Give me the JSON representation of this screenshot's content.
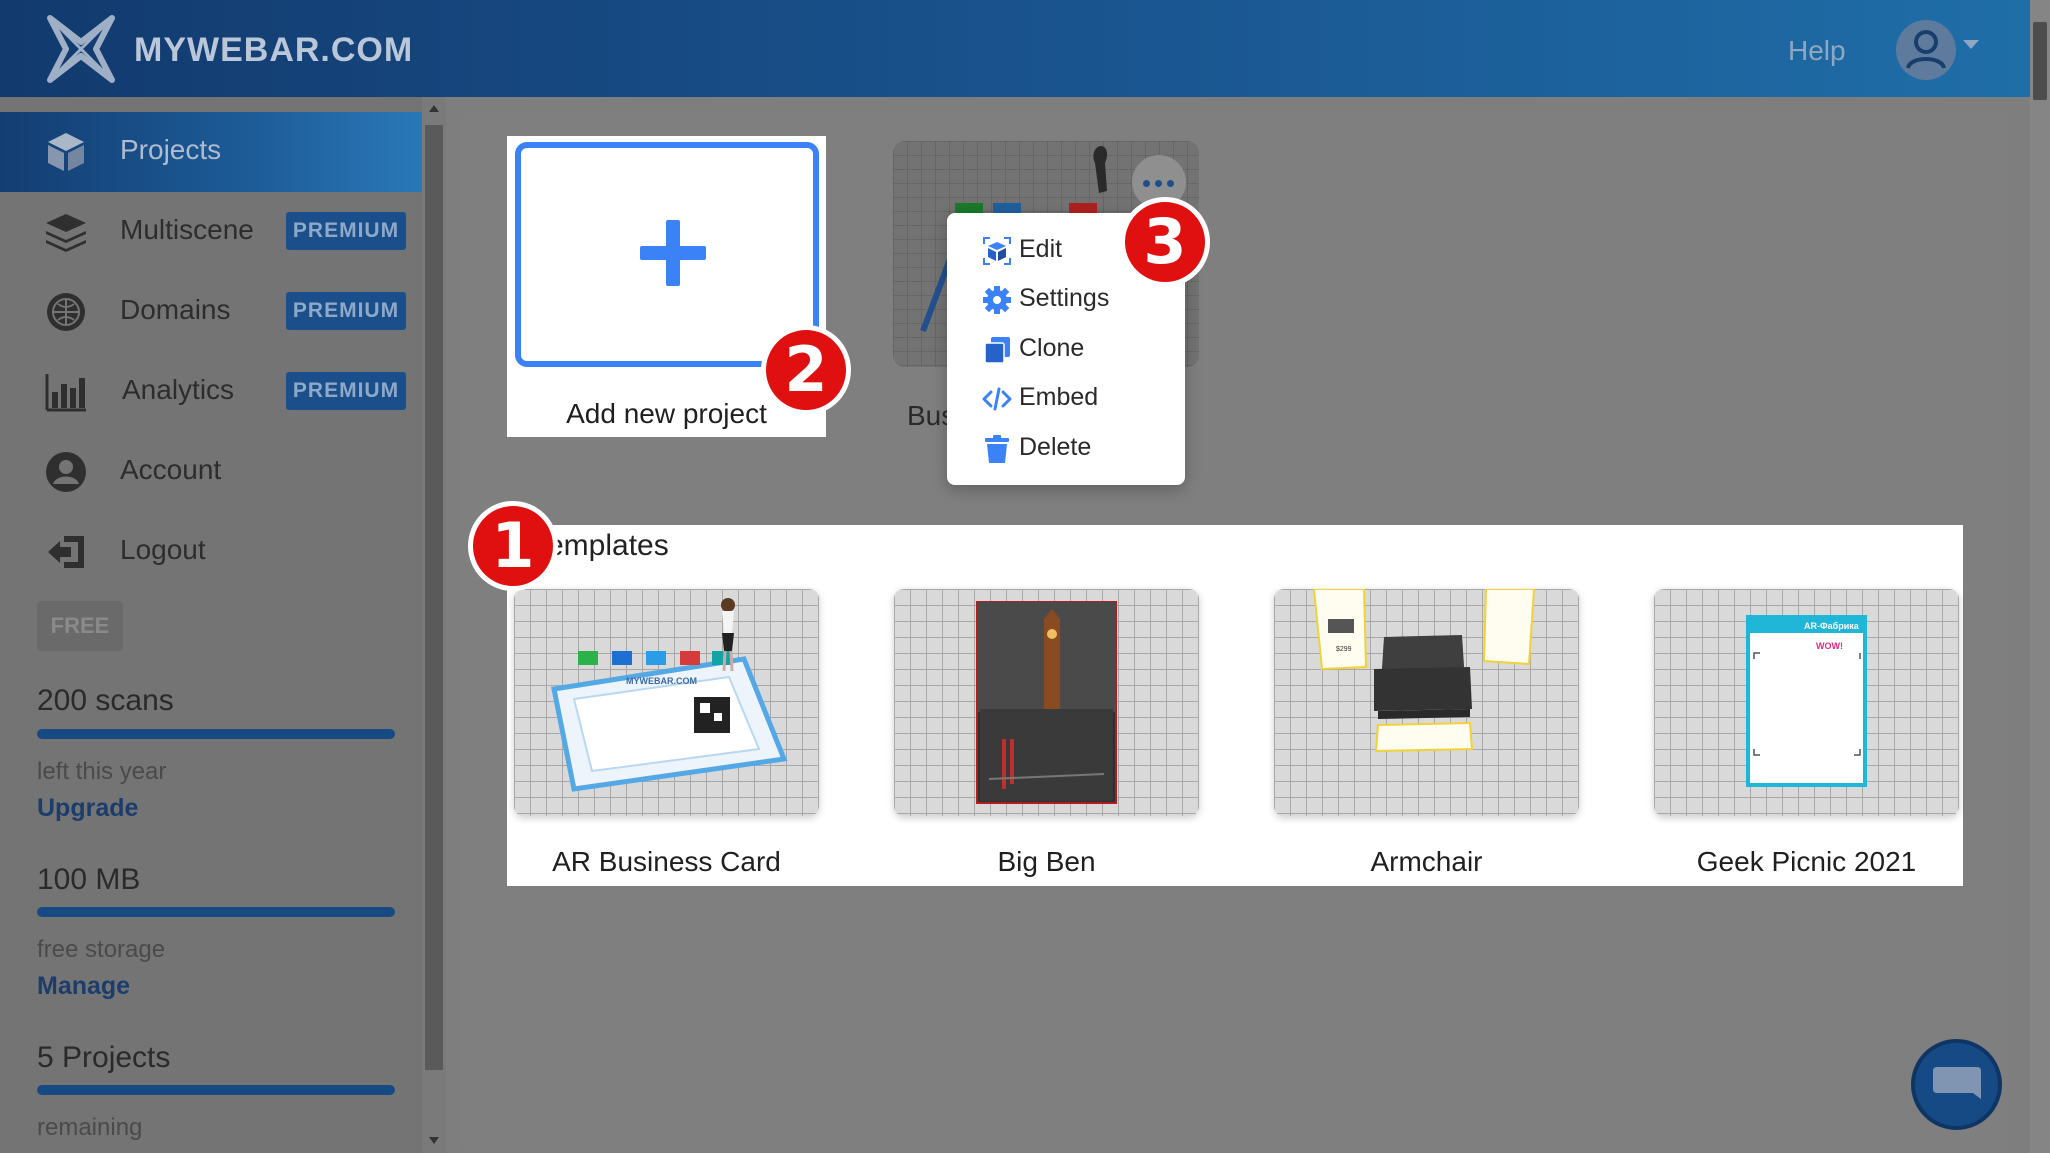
{
  "header": {
    "brand": "MYWEBAR.COM",
    "help": "Help"
  },
  "sidebar": {
    "items": [
      {
        "label": "Projects",
        "badge": ""
      },
      {
        "label": "Multiscene",
        "badge": "PREMIUM"
      },
      {
        "label": "Domains",
        "badge": "PREMIUM"
      },
      {
        "label": "Analytics",
        "badge": "PREMIUM"
      },
      {
        "label": "Account",
        "badge": ""
      },
      {
        "label": "Logout",
        "badge": ""
      }
    ],
    "plan": "FREE",
    "stats": [
      {
        "title": "200 scans",
        "sub": "left this year",
        "link": "Upgrade"
      },
      {
        "title": "100 MB",
        "sub": "free storage",
        "link": "Manage"
      },
      {
        "title": "5 Projects",
        "sub": "remaining",
        "link": ""
      }
    ]
  },
  "projects": {
    "add_label": "Add new project",
    "card_label_partial": "Bus",
    "menu": [
      {
        "label": "Edit",
        "icon": "edit-cube-icon"
      },
      {
        "label": "Settings",
        "icon": "gear-icon"
      },
      {
        "label": "Clone",
        "icon": "clone-icon"
      },
      {
        "label": "Embed",
        "icon": "code-icon"
      },
      {
        "label": "Delete",
        "icon": "trash-icon"
      }
    ]
  },
  "templates": {
    "title_visible": "emplates",
    "items": [
      {
        "label": "AR Business Card"
      },
      {
        "label": "Big Ben"
      },
      {
        "label": "Armchair"
      },
      {
        "label": "Geek Picnic 2021"
      }
    ]
  },
  "thumb_text": {
    "card_brand": "MYWEBAR.COM",
    "price": "$299",
    "poster_title": "AR-Фабрика",
    "poster_wow": "WOW!"
  },
  "markers": [
    "1",
    "2",
    "3"
  ],
  "colors": {
    "accent": "#3b82f6",
    "marker": "#e11010",
    "header": "#1a5590",
    "premium": "#1b4f8c"
  }
}
